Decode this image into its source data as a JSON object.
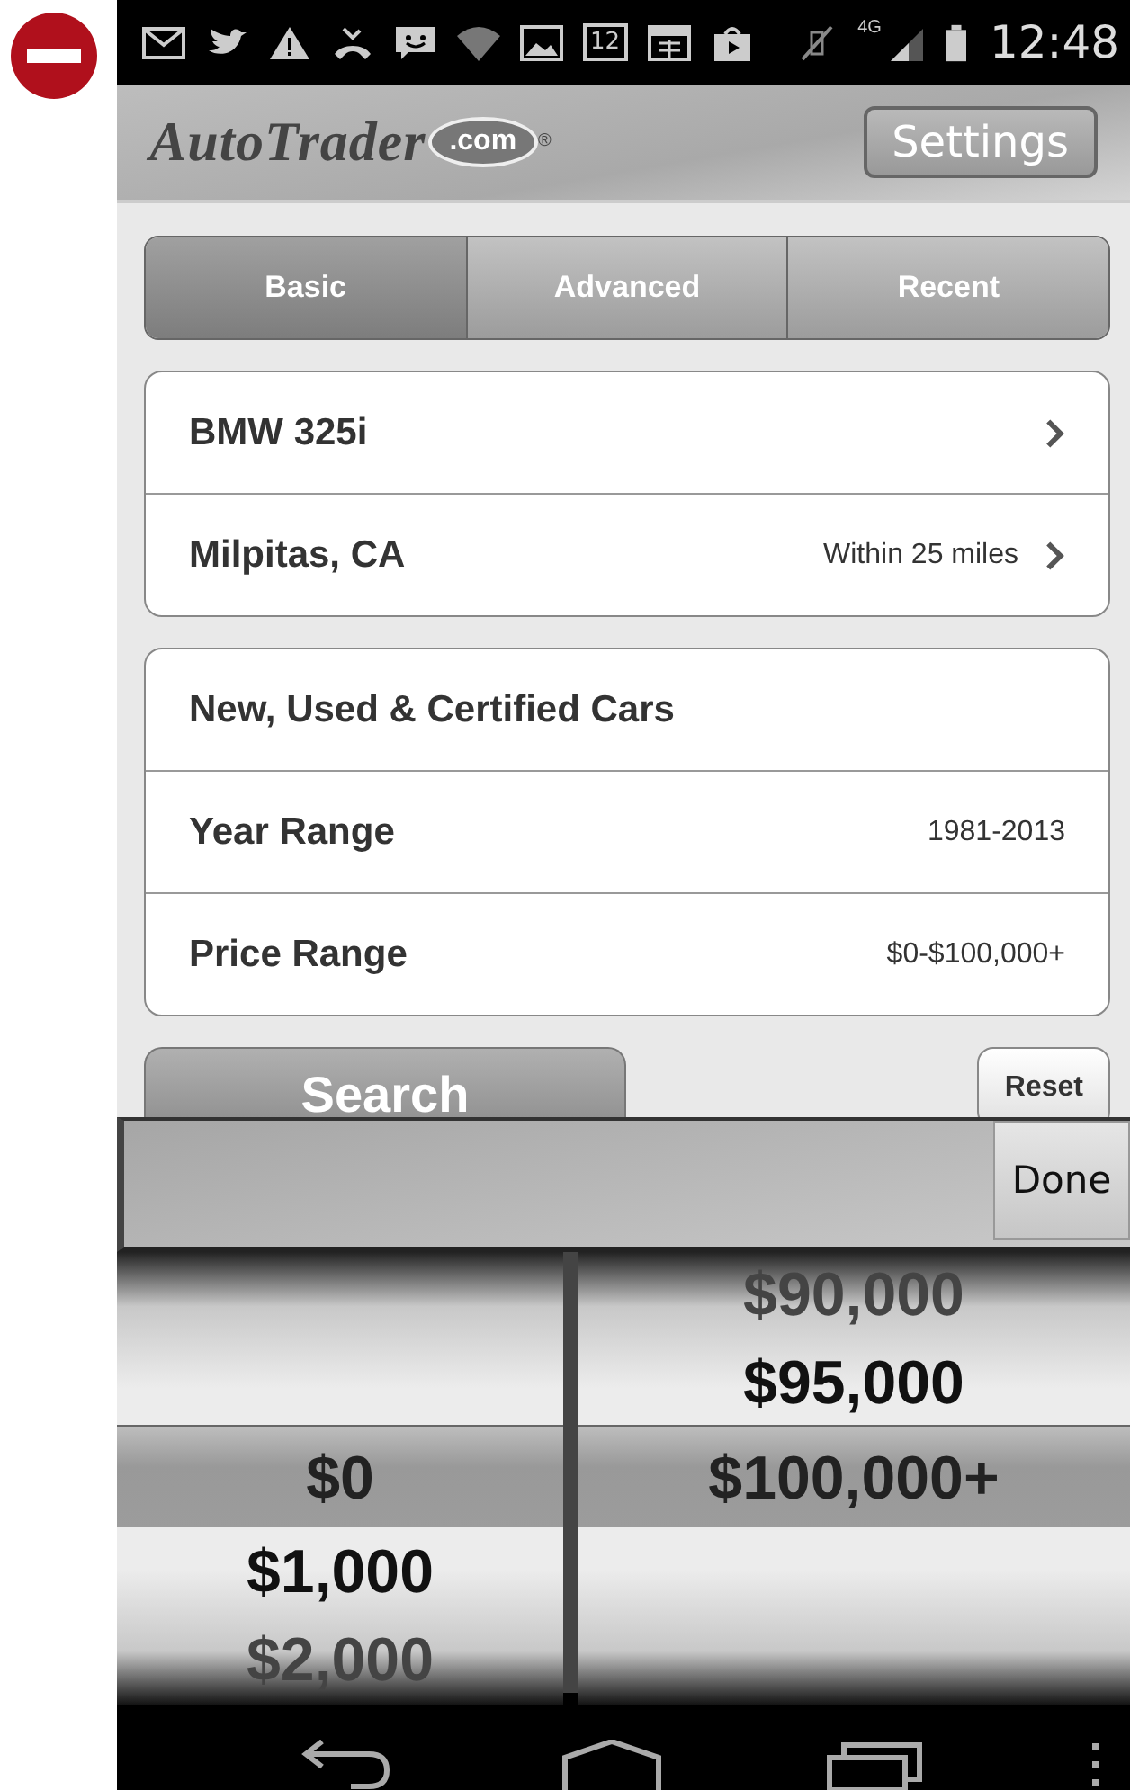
{
  "status_bar": {
    "calendar_day": "12",
    "network": "4G",
    "time": "12:48"
  },
  "header": {
    "logo": "AutoTrader",
    "logo_suffix": ".com",
    "logo_mark": "®",
    "settings": "Settings"
  },
  "tabs": [
    {
      "label": "Basic",
      "selected": true
    },
    {
      "label": "Advanced",
      "selected": false
    },
    {
      "label": "Recent",
      "selected": false
    }
  ],
  "vehicle_group": [
    {
      "label": "BMW 325i",
      "chevron": true
    },
    {
      "label": "Milpitas, CA",
      "value": "Within 25 miles",
      "chevron": true
    }
  ],
  "filter_group": [
    {
      "label": "New, Used & Certified Cars",
      "chevron": false
    },
    {
      "label": "Year Range",
      "value": "1981-2013",
      "chevron": false
    },
    {
      "label": "Price Range",
      "value": "$0-$100,000+",
      "chevron": false
    }
  ],
  "actions": {
    "search": "Search",
    "reset": "Reset"
  },
  "picker": {
    "done": "Done",
    "columns": [
      {
        "items": [
          {
            "label": "$0",
            "selected": true
          },
          {
            "label": "$1,000",
            "selected": false
          },
          {
            "label": "$2,000",
            "selected": false
          }
        ]
      },
      {
        "items": [
          {
            "label": "$90,000",
            "selected": false
          },
          {
            "label": "$95,000",
            "selected": false
          },
          {
            "label": "$100,000+",
            "selected": true
          }
        ]
      }
    ]
  }
}
